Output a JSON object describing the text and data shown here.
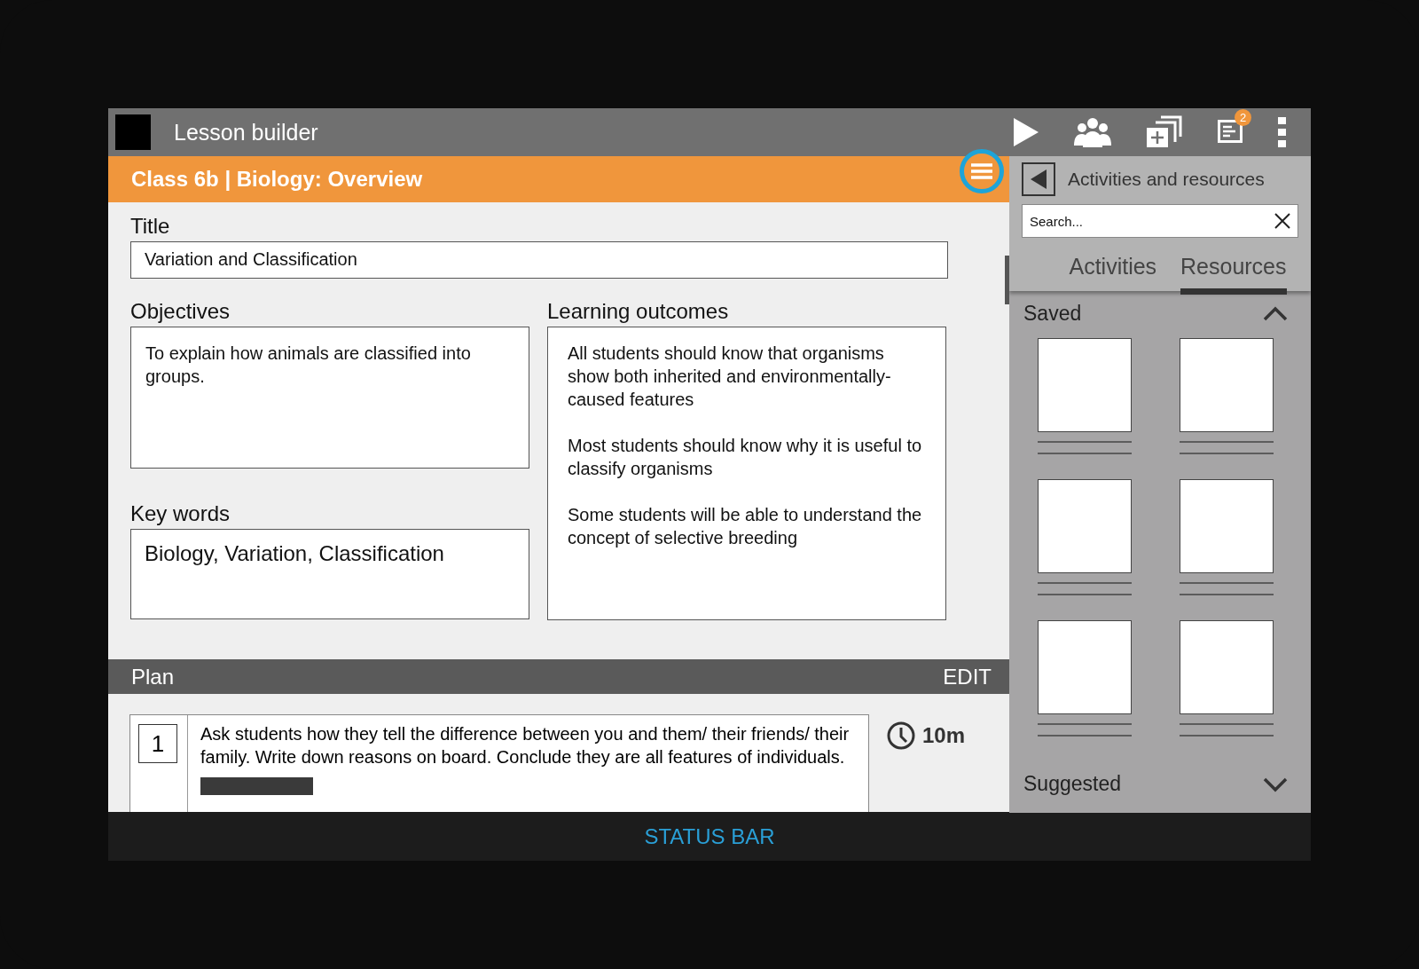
{
  "app_bar": {
    "title": "Lesson builder",
    "notification_count": "2"
  },
  "header": {
    "title": "Class 6b | Biology: Overview"
  },
  "form": {
    "title_label": "Title",
    "title_value": "Variation and Classification",
    "objectives_label": "Objectives",
    "objectives_value": "To explain how animals are classified into groups.",
    "keywords_label": "Key words",
    "keywords_value": "Biology, Variation, Classification",
    "outcomes_label": "Learning outcomes",
    "outcomes": [
      "All students should know that organisms show both inherited and environmentally-caused features",
      "Most students should know why it is useful to classify organisms",
      "Some students will be able to understand the concept of selective breeding"
    ]
  },
  "plan": {
    "title": "Plan",
    "action": "EDIT",
    "steps": [
      {
        "number": "1",
        "text": "Ask students how they tell the difference between you and them/ their friends/ their family. Write down reasons on board. Conclude they are all features of individuals.",
        "duration": "10m"
      }
    ]
  },
  "panel": {
    "title": "Activities and resources",
    "search": {
      "placeholder": "Search..."
    },
    "tabs": [
      {
        "label": "Activities",
        "selected": false
      },
      {
        "label": "Resources",
        "selected": true
      }
    ],
    "sections": [
      {
        "title": "Saved",
        "expanded": true,
        "items": [
          {
            "kind": "card"
          },
          {
            "kind": "card"
          },
          {
            "kind": "card"
          },
          {
            "kind": "card"
          },
          {
            "kind": "card"
          },
          {
            "kind": "card"
          }
        ]
      },
      {
        "title": "Suggested",
        "expanded": false
      }
    ]
  },
  "status_bar": "STATUS BAR"
}
